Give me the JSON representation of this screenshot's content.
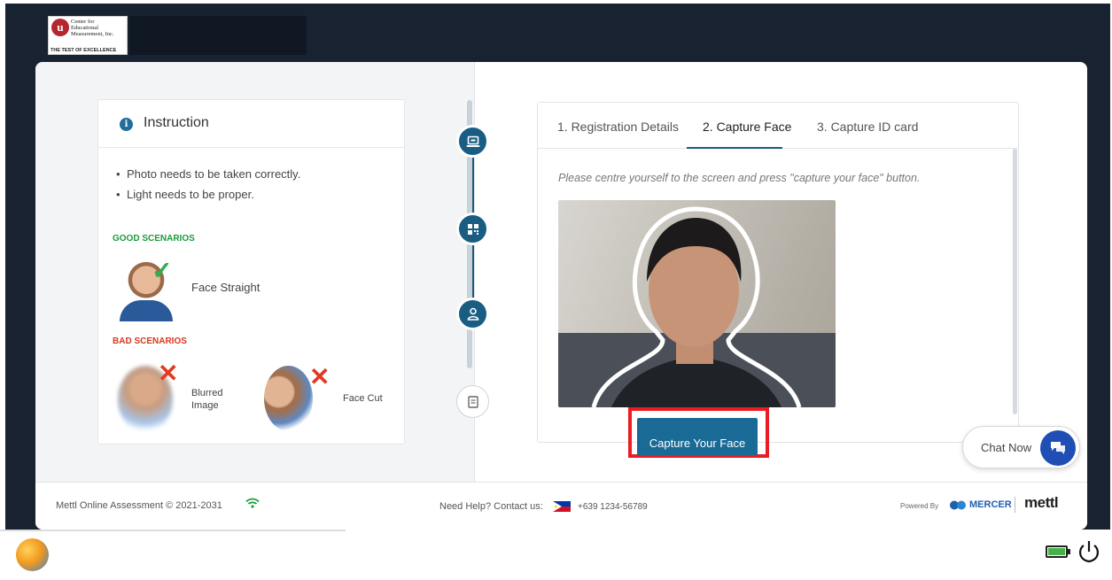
{
  "brand": {
    "logo_letter": "u",
    "logo_lines": [
      "Center for",
      "Educational",
      "Measurement, Inc."
    ],
    "tagline": "THE TEST OF EXCELLENCE"
  },
  "instruction": {
    "title": "Instruction",
    "bullets": [
      "Photo needs to be taken correctly.",
      "Light needs to be proper."
    ],
    "good_heading": "GOOD SCENARIOS",
    "good_items": [
      {
        "label": "Face Straight"
      }
    ],
    "bad_heading": "BAD SCENARIOS",
    "bad_items": [
      {
        "label": "Blurred Image"
      },
      {
        "label": "Face Cut"
      }
    ]
  },
  "stepper": {
    "steps": [
      {
        "icon": "laptop-icon",
        "state": "done"
      },
      {
        "icon": "qr-code-icon",
        "state": "done"
      },
      {
        "icon": "user-icon",
        "state": "current"
      },
      {
        "icon": "document-icon",
        "state": "pending"
      }
    ]
  },
  "capture": {
    "tabs": [
      {
        "label": "1. Registration Details",
        "active": false
      },
      {
        "label": "2. Capture Face",
        "active": true
      },
      {
        "label": "3. Capture ID card",
        "active": false
      }
    ],
    "hint": "Please centre yourself to the screen and press \"capture your face\" button.",
    "button_label": "Capture Your Face"
  },
  "chat": {
    "label": "Chat Now"
  },
  "footer": {
    "copyright": "Mettl Online Assessment © 2021-2031",
    "help_label": "Need Help? Contact us:",
    "phone": "+639 1234-56789",
    "powered_by": "Powered By",
    "mercer": "MERCER",
    "mettl": "mettl"
  },
  "colors": {
    "primary": "#1a5d82",
    "highlight": "#ea1c24",
    "good": "#1a9b3a",
    "bad": "#d9381e",
    "chat": "#1f4fb5"
  }
}
